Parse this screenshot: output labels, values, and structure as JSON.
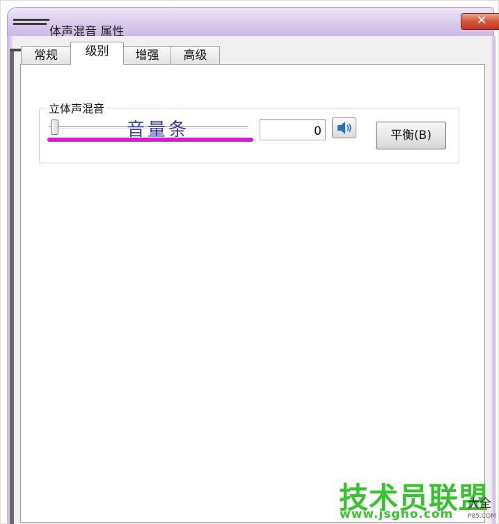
{
  "window": {
    "title": "体声混音 属性",
    "close_label": "✕"
  },
  "tabs": [
    {
      "label": "常规",
      "active": false
    },
    {
      "label": "级别",
      "active": true
    },
    {
      "label": "增强",
      "active": false
    },
    {
      "label": "高级",
      "active": false
    }
  ],
  "level_group": {
    "label": "立体声混音",
    "slider_level_percent": 0,
    "annotation": "音量条",
    "value": "0",
    "mute_icon": "speaker-icon",
    "balance_label": "平衡(B)"
  },
  "watermark": {
    "main": "技术员联盟",
    "sub": "www.jsgho.com",
    "side": "大全",
    "tiny": "P85.COM"
  },
  "colors": {
    "title_gradient": "#d9c8ec",
    "close": "#d4553a",
    "annotation": "#3b3fa0",
    "underline": "#d21fd2",
    "watermark": "#37c32d"
  }
}
